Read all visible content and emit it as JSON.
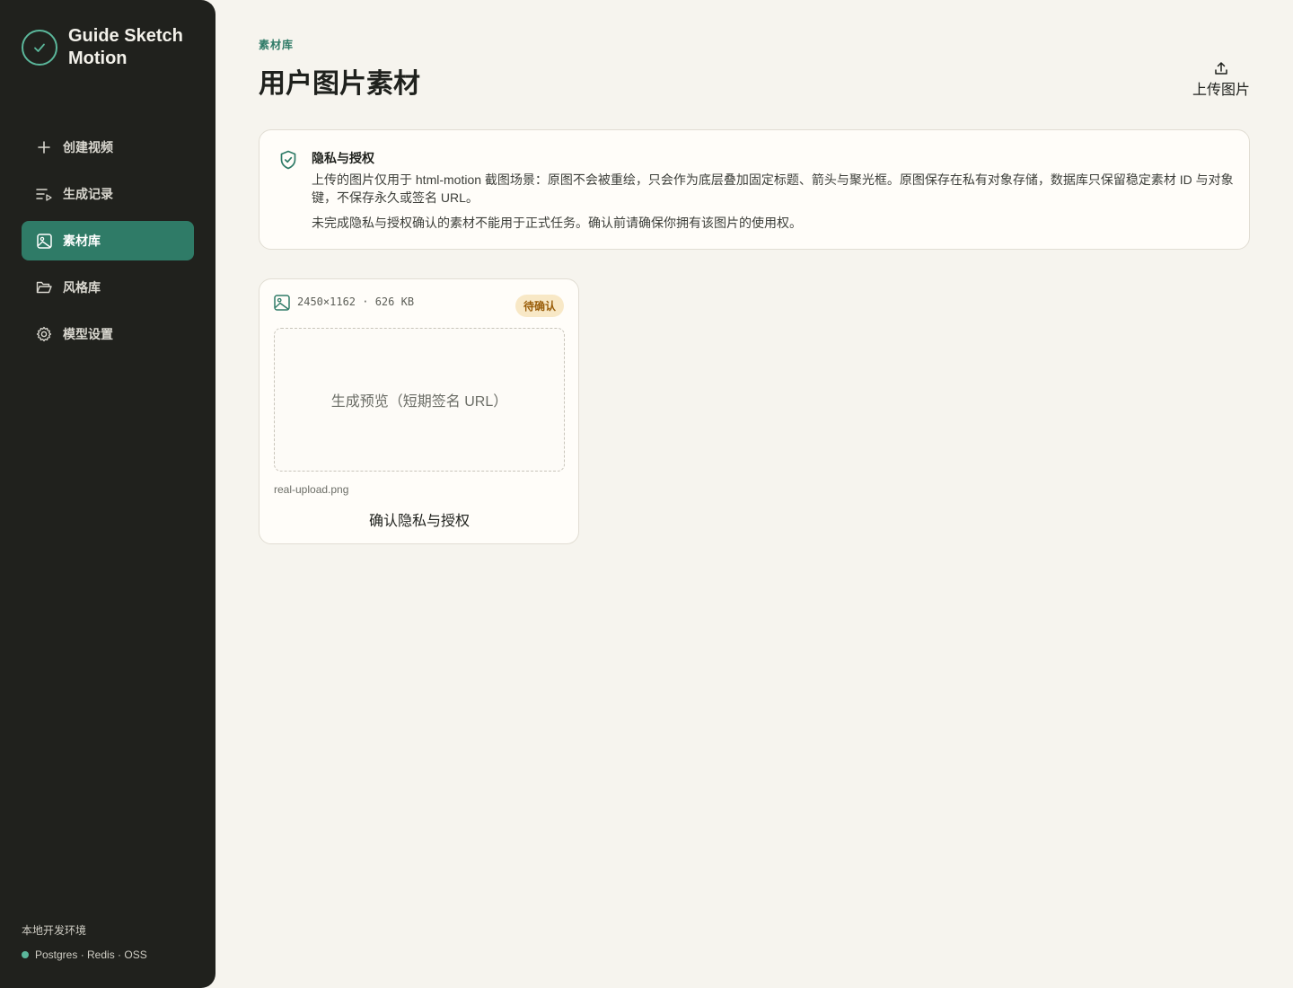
{
  "app": {
    "brand_name": "Guide Sketch Motion",
    "accent": "#2f7b67",
    "sidebar_bg": "#20211d"
  },
  "sidebar": {
    "items": [
      {
        "label": "创建视频",
        "icon": "plus-icon",
        "active": false
      },
      {
        "label": "生成记录",
        "icon": "list-play-icon",
        "active": false
      },
      {
        "label": "素材库",
        "icon": "image-icon",
        "active": true
      },
      {
        "label": "风格库",
        "icon": "folder-open-icon",
        "active": false
      },
      {
        "label": "模型设置",
        "icon": "gear-icon",
        "active": false
      }
    ],
    "env_title": "本地开发环境",
    "env_services": "Postgres · Redis · OSS"
  },
  "header": {
    "eyebrow": "素材库",
    "title": "用户图片素材",
    "upload_label": "上传图片"
  },
  "notice": {
    "icon": "shield-check-icon",
    "title": "隐私与授权",
    "p1": "上传的图片仅用于 html-motion 截图场景：原图不会被重绘，只会作为底层叠加固定标题、箭头与聚光框。原图保存在私有对象存储，数据库只保留稳定素材 ID 与对象键，不保存永久或签名 URL。",
    "p2": "未完成隐私与授权确认的素材不能用于正式任务。确认前请确保你拥有该图片的使用权。"
  },
  "assets": [
    {
      "meta": "2450×1162 · 626 KB",
      "status": "待确认",
      "preview_text": "生成预览（短期签名 URL）",
      "file_name": "real-upload.png",
      "confirm_label": "确认隐私与授权"
    }
  ]
}
